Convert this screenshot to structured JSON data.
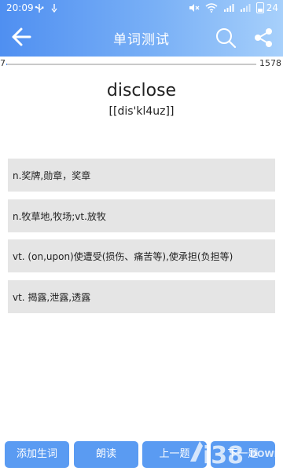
{
  "status_bar": {
    "time": "20:09",
    "battery": "24",
    "icons": [
      "usb-icon",
      "vibrate-icon",
      "mute-icon",
      "wifi-icon",
      "signal-icon",
      "signal-icon",
      "battery-icon"
    ]
  },
  "header": {
    "title": "单词测试",
    "back_icon": "arrow-left-icon",
    "search_icon": "search-icon",
    "share_icon": "share-icon"
  },
  "progress": {
    "current": "7",
    "total": "1578"
  },
  "word": {
    "text": "disclose",
    "phonetic": "[[dis'kl4uz]]"
  },
  "options": [
    "n.奖牌,勋章，奖章",
    "n.牧草地,牧场;vt.放牧",
    "vt. (on,upon)使遭受(损伤、痛苦等),使承担(负担等)",
    "vt. 揭露,泄露,透露"
  ],
  "buttons": {
    "add": "添加生词",
    "read": "朗读",
    "prev": "上一题",
    "next": "下一题"
  },
  "watermark": {
    "text": "i38",
    "subtext": "DOWN"
  },
  "colors": {
    "header_start": "#4f8ff1",
    "header_end": "#a7d0fb",
    "button": "#5a9bf2",
    "option_bg": "#e5e5e5"
  }
}
